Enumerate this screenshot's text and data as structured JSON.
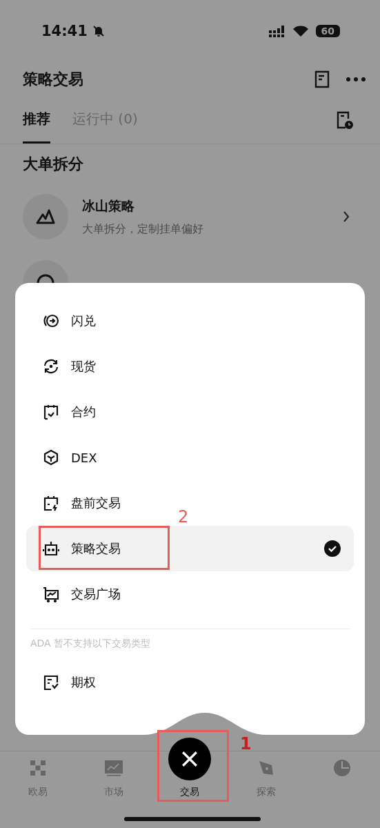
{
  "status_bar": {
    "time": "14:41",
    "battery": "60"
  },
  "header": {
    "title": "策略交易"
  },
  "tabs": [
    {
      "label": "推荐",
      "selected": true
    },
    {
      "label": "运行中 (0)",
      "selected": false
    }
  ],
  "section": {
    "title": "大单拆分"
  },
  "strategies": [
    {
      "kind": "mountain",
      "title": "冰山策略",
      "subtitle": "大单拆分，定制挂单偏好"
    },
    {
      "kind": "clock"
    }
  ],
  "menu": {
    "items": [
      {
        "kind": "swap",
        "label": "闪兑",
        "selected": false
      },
      {
        "kind": "cycle",
        "label": "现货",
        "selected": false
      },
      {
        "kind": "contract",
        "label": "合约",
        "selected": false
      },
      {
        "kind": "cube",
        "label": "DEX",
        "selected": false
      },
      {
        "kind": "premarket",
        "label": "盘前交易",
        "selected": false
      },
      {
        "kind": "robot",
        "label": "策略交易",
        "selected": true
      },
      {
        "kind": "cart",
        "label": "交易广场",
        "selected": false
      }
    ],
    "note": "ADA 暂不支持以下交易类型",
    "unsupported": [
      {
        "kind": "option",
        "label": "期权"
      }
    ]
  },
  "nav": [
    {
      "kind": "logo",
      "label": "欧易",
      "selected": false
    },
    {
      "kind": "chart",
      "label": "市场",
      "selected": false
    },
    {
      "kind": "close",
      "label": "交易",
      "selected": true
    },
    {
      "kind": "compass",
      "label": "探索",
      "selected": false
    },
    {
      "kind": "pie",
      "selected": false
    }
  ],
  "annotations": [
    {
      "label": "1"
    },
    {
      "label": "2"
    }
  ]
}
